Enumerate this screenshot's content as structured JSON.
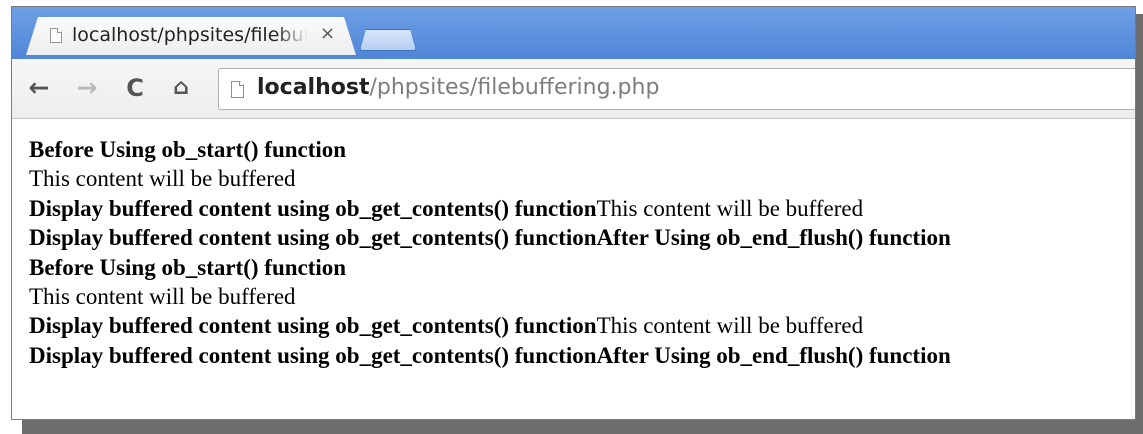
{
  "tab": {
    "title": "localhost/phpsites/filebuffering.php",
    "close_glyph": "×"
  },
  "toolbar": {
    "back_glyph": "←",
    "forward_glyph": "→",
    "reload_glyph": "C",
    "home_glyph": "⌂"
  },
  "address": {
    "host": "localhost",
    "path": "/phpsites/filebuffering.php"
  },
  "content": {
    "lines": [
      {
        "bold": "Before Using ob_start() function",
        "normal": ""
      },
      {
        "bold": "",
        "normal": "This content will be buffered"
      },
      {
        "bold": "Display buffered content using ob_get_contents() function",
        "normal": "This content will be buffered"
      },
      {
        "bold": "Display buffered content using ob_get_contents() functionAfter Using ob_end_flush() function",
        "normal": ""
      },
      {
        "bold": "Before Using ob_start() function",
        "normal": ""
      },
      {
        "bold": "",
        "normal": "This content will be buffered"
      },
      {
        "bold": "Display buffered content using ob_get_contents() function",
        "normal": "This content will be buffered"
      },
      {
        "bold": "Display buffered content using ob_get_contents() functionAfter Using ob_end_flush() function",
        "normal": ""
      }
    ]
  },
  "icons": {
    "tab_favicon": "page-icon",
    "omnibox_icon": "page-icon",
    "back": "arrow-left-icon",
    "forward": "arrow-right-icon",
    "reload": "reload-icon",
    "home": "home-icon"
  },
  "colors": {
    "tabstrip": "#4f86d6",
    "url_host": "#222222",
    "url_path": "#7d7d7d"
  }
}
